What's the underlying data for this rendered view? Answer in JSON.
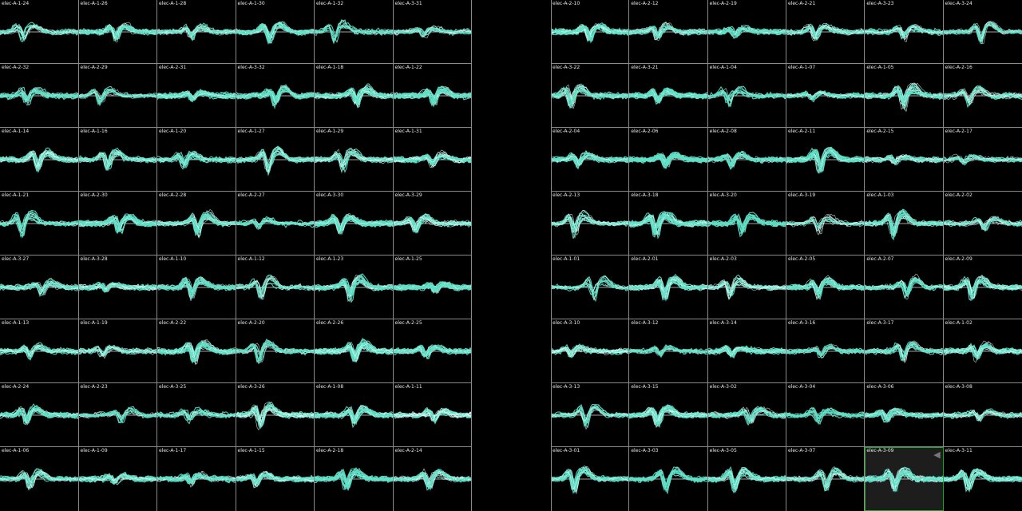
{
  "theme": {
    "background": "#000000",
    "trace_color": "#5fe0c6",
    "grid_color": "#8a8a8a",
    "selected_border": "#1fa52d"
  },
  "left_panel": {
    "rows": [
      [
        "elec-A-1-24",
        "elec-A-1-26",
        "elec-A-1-28",
        "elec-A-1-30",
        "elec-A-1-32",
        "elec-A-3-31"
      ],
      [
        "elec-A-2-32",
        "elec-A-2-29",
        "elec-A-2-31",
        "elec-A-3-32",
        "elec-A-1-18",
        "elec-A-1-22"
      ],
      [
        "elec-A-1-14",
        "elec-A-1-16",
        "elec-A-1-20",
        "elec-A-1-27",
        "elec-A-1-29",
        "elec-A-1-31"
      ],
      [
        "elec-A-1-21",
        "elec-A-2-30",
        "elec-A-2-28",
        "elec-A-2-27",
        "elec-A-3-30",
        "elec-A-3-29"
      ],
      [
        "elec-A-3-27",
        "elec-A-3-28",
        "elec-A-1-10",
        "elec-A-1-12",
        "elec-A-1-23",
        "elec-A-1-25"
      ],
      [
        "elec-A-1-13",
        "elec-A-1-19",
        "elec-A-2-22",
        "elec-A-2-20",
        "elec-A-2-26",
        "elec-A-2-25"
      ],
      [
        "elec-A-2-24",
        "elec-A-2-23",
        "elec-A-3-25",
        "elec-A-3-26",
        "elec-A-1-08",
        "elec-A-1-11"
      ],
      [
        "elec-A-1-06",
        "elec-A-1-09",
        "elec-A-1-17",
        "elec-A-1-15",
        "elec-A-2-18",
        "elec-A-2-14"
      ]
    ]
  },
  "right_panel": {
    "rows": [
      [
        "elec-A-2-10",
        "elec-A-2-12",
        "elec-A-2-19",
        "elec-A-2-21",
        "elec-A-3-23",
        "elec-A-3-24"
      ],
      [
        "elec-A-3-22",
        "elec-A-3-21",
        "elec-A-1-04",
        "elec-A-1-07",
        "elec-A-1-05",
        "elec-A-2-16"
      ],
      [
        "elec-A-2-04",
        "elec-A-2-06",
        "elec-A-2-08",
        "elec-A-2-11",
        "elec-A-2-15",
        "elec-A-2-17"
      ],
      [
        "elec-A-2-13",
        "elec-A-3-18",
        "elec-A-3-20",
        "elec-A-3-19",
        "elec-A-1-03",
        "elec-A-2-02"
      ],
      [
        "elec-A-1-01",
        "elec-A-2-01",
        "elec-A-2-03",
        "elec-A-2-05",
        "elec-A-2-07",
        "elec-A-2-09"
      ],
      [
        "elec-A-3-10",
        "elec-A-3-12",
        "elec-A-3-14",
        "elec-A-3-16",
        "elec-A-3-17",
        "elec-A-1-02"
      ],
      [
        "elec-A-3-13",
        "elec-A-3-15",
        "elec-A-3-02",
        "elec-A-3-04",
        "elec-A-3-06",
        "elec-A-3-08"
      ],
      [
        "elec-A-3-01",
        "elec-A-3-03",
        "elec-A-3-05",
        "elec-A-3-07",
        "elec-A-3-09",
        "elec-A-3-11"
      ]
    ]
  },
  "selected_channel": "elec-A-3-09",
  "selected_icon": "speaker-icon"
}
